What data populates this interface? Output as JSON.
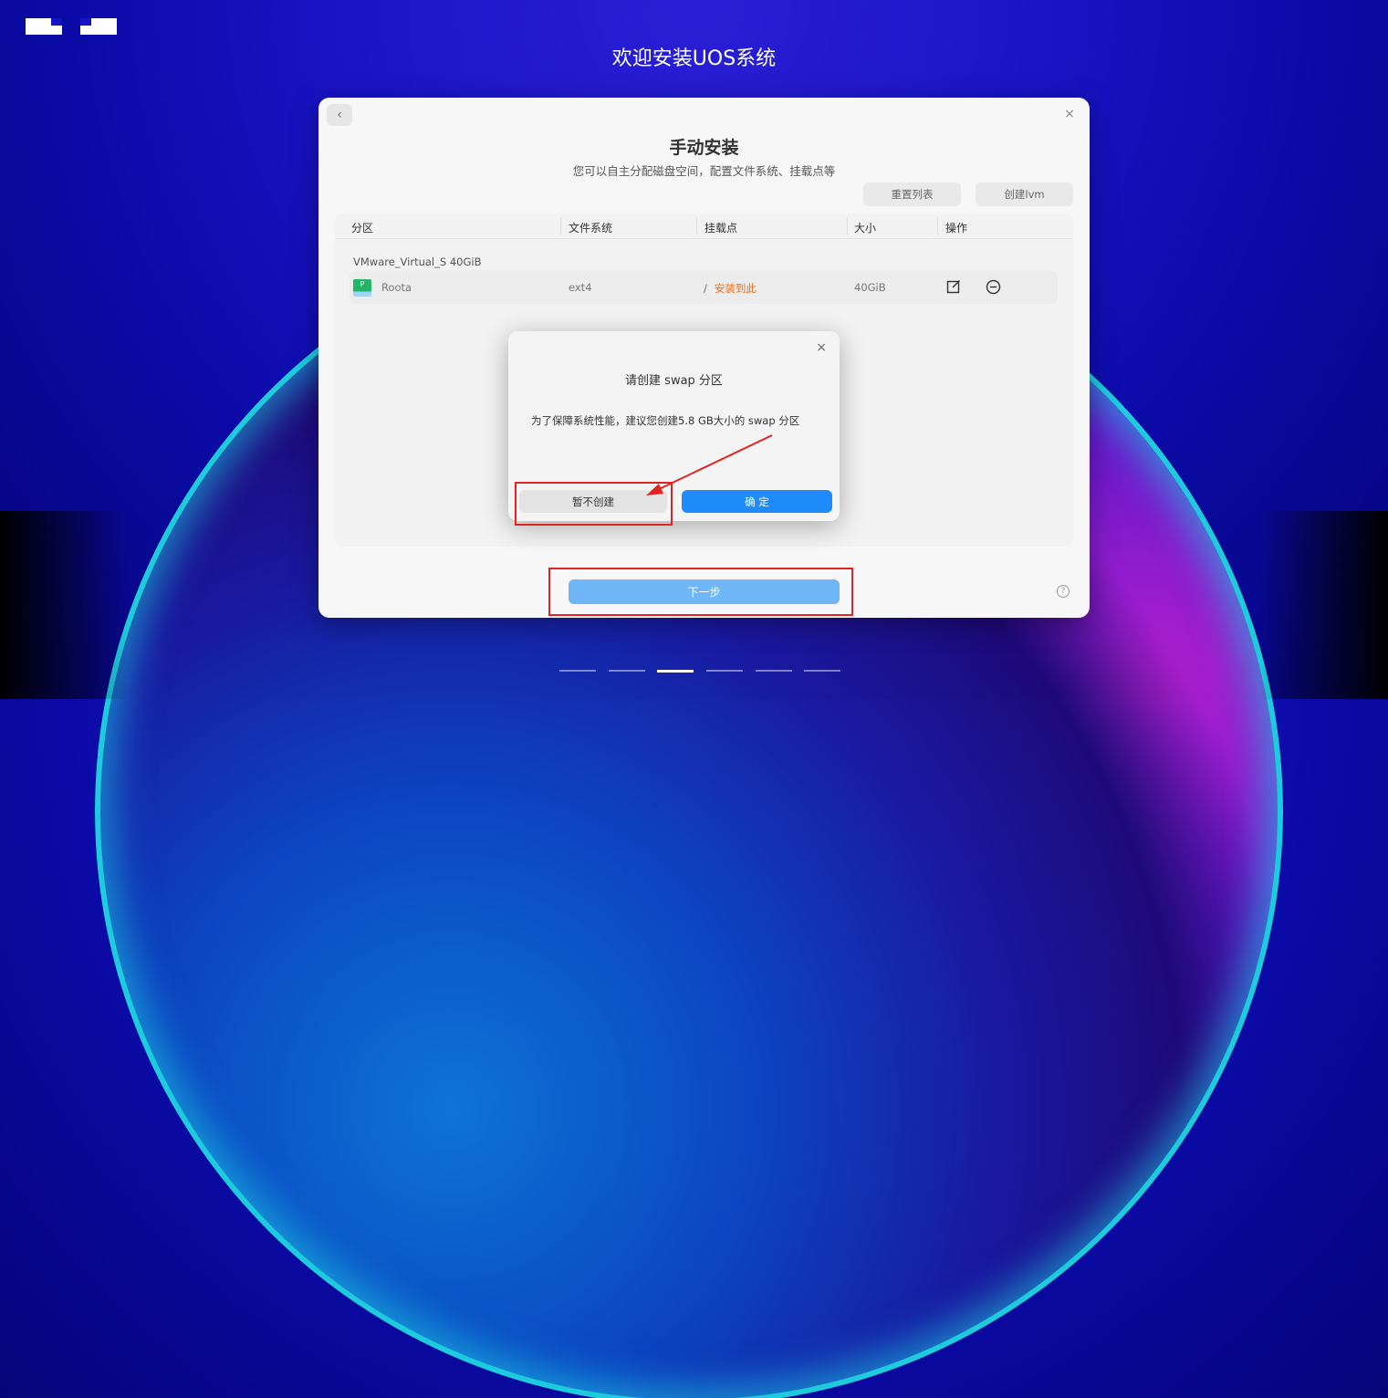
{
  "header": {
    "welcome_title": "欢迎安装UOS系统"
  },
  "main_card": {
    "title": "手动安装",
    "subtitle": "您可以自主分配磁盘空间，配置文件系统、挂载点等",
    "reset_button": "重置列表",
    "lvm_button": "创建lvm",
    "columns": [
      "分区",
      "文件系统",
      "挂载点",
      "大小",
      "操作"
    ],
    "disk": {
      "label": "VMware_Virtual_S 40GiB"
    },
    "partition": {
      "icon_letter": "P",
      "name": "Roota",
      "filesystem": "ext4",
      "mount_slash": "/",
      "mount_note": "安装到此",
      "size": "40GiB"
    },
    "next_button": "下一步",
    "help_symbol": "?"
  },
  "dialog": {
    "title": "请创建 swap 分区",
    "message": "为了保障系统性能，建议您创建5.8 GB大小的 swap 分区",
    "skip_button": "暂不创建",
    "confirm_button": "确 定",
    "close_symbol": "×"
  },
  "close_symbol": "×",
  "back_symbol": "‹",
  "progress": {
    "total_steps": 6,
    "current_step": 3
  },
  "colors": {
    "accent_blue": "#1f8bfa",
    "next_button_blue": "#6fb6f7",
    "mount_note_orange": "#f06a14",
    "annotation_red": "#e32222"
  }
}
